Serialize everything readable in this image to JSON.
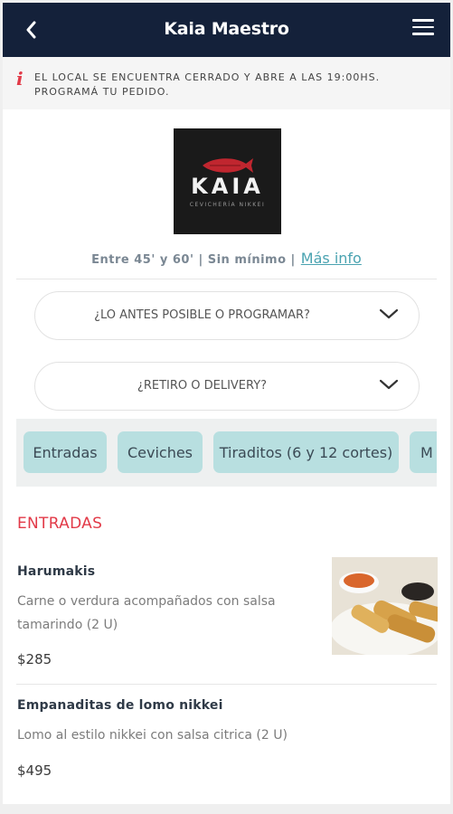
{
  "header": {
    "title": "Kaia Maestro",
    "back_icon": "chevron-left-icon",
    "menu_icon": "hamburger-menu-icon"
  },
  "alert": {
    "icon": "info-icon",
    "icon_glyph": "i",
    "text": "EL LOCAL SE ENCUENTRA CERRADO Y ABRE A LAS 19:00HS. PROGRAMÁ TU PEDIDO."
  },
  "store": {
    "logo_text": "KAIA",
    "logo_subtext": "CEVICHERÍA NIKKEI",
    "delivery_info": "Entre 45' y 60' | Sin mínimo |",
    "more_info_label": "Más info"
  },
  "selectors": {
    "schedule_label": "¿LO ANTES POSIBLE O PROGRAMAR?",
    "mode_label": "¿RETIRO O DELIVERY?"
  },
  "categories": [
    "Entradas",
    "Ceviches",
    "Tiraditos (6 y 12 cortes)",
    "M"
  ],
  "section": {
    "title": "ENTRADAS"
  },
  "products": [
    {
      "name": "Harumakis",
      "description": "Carne o verdura acompañados con salsa tamarindo (2 U)",
      "price": "$285"
    },
    {
      "name": "Empanaditas de lomo nikkei",
      "description": "Lomo al estilo nikkei con salsa citrica (2 U)",
      "price": "$495"
    }
  ],
  "colors": {
    "header_bg": "#14213a",
    "accent_red": "#e23a48",
    "link_teal": "#4aa3b1",
    "category_bg": "#b8dfe0"
  }
}
